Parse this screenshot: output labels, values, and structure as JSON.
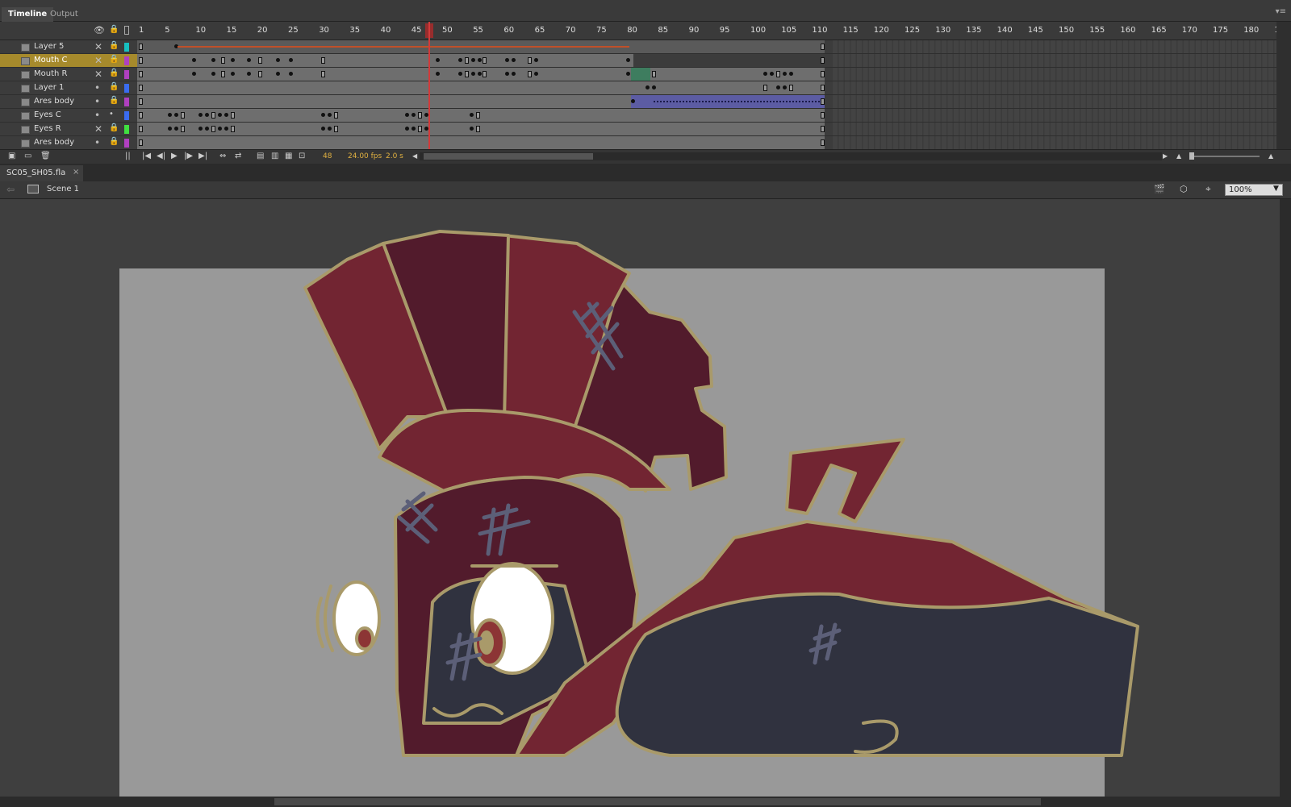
{
  "panel_tabs": [
    {
      "label": "Timeline"
    },
    {
      "label": "Output"
    }
  ],
  "ruler_labels": [
    "1",
    "5",
    "10",
    "15",
    "20",
    "25",
    "30",
    "35",
    "40",
    "45",
    "50",
    "55",
    "60",
    "65",
    "70",
    "75",
    "80",
    "85",
    "90",
    "95",
    "100",
    "105",
    "110",
    "115",
    "120",
    "125",
    "130",
    "135",
    "140",
    "145",
    "150",
    "155",
    "160",
    "165",
    "170",
    "175",
    "180",
    "1"
  ],
  "layers": [
    {
      "name": "Layer 5",
      "color": "#17c0c0",
      "hidden": true,
      "locked": true,
      "selected": false
    },
    {
      "name": "Mouth C",
      "color": "#b040c0",
      "hidden": true,
      "locked": true,
      "selected": true
    },
    {
      "name": "Mouth R",
      "color": "#b040c0",
      "hidden": true,
      "locked": true,
      "selected": false
    },
    {
      "name": "Layer 1",
      "color": "#3a6cf0",
      "hidden": false,
      "locked": true,
      "selected": false
    },
    {
      "name": "Ares body",
      "color": "#b040c0",
      "hidden": false,
      "locked": true,
      "selected": false
    },
    {
      "name": "Eyes C",
      "color": "#3a6cf0",
      "hidden": false,
      "locked": false,
      "selected": false
    },
    {
      "name": "Eyes R",
      "color": "#40e040",
      "hidden": true,
      "locked": true,
      "selected": false
    },
    {
      "name": "Ares body",
      "color": "#b040c0",
      "hidden": false,
      "locked": true,
      "selected": false
    }
  ],
  "timeline_status": {
    "frame": "48",
    "fps": "24.00 fps",
    "time": "2.0 s"
  },
  "document": {
    "tab_label": "SC05_SH05.fla",
    "close": "×",
    "scene": "Scene 1",
    "zoom": "100%"
  },
  "colors": {
    "stage": "#999999",
    "pasteboard": "#3f3f3f",
    "playhead": "#d23a3a",
    "helmet_dark": "#521b2c",
    "helmet_red": "#722532",
    "body_navy": "#30323f",
    "outline": "#a99a6a"
  }
}
